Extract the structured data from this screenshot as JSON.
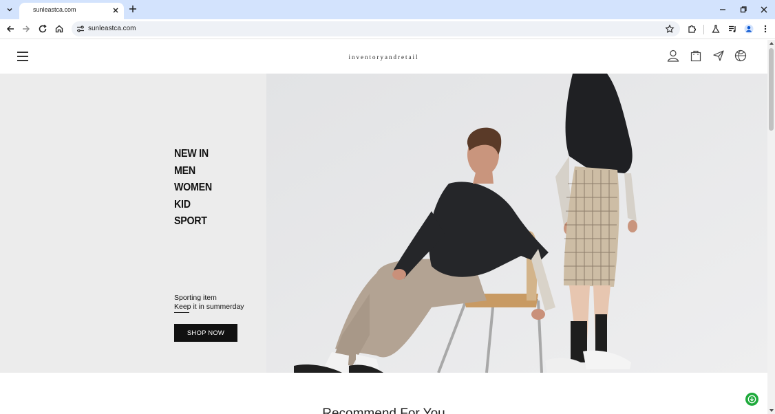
{
  "browser": {
    "tab_title": "sunleastca.com",
    "url": "sunleastca.com"
  },
  "site": {
    "brand": "inventoryandretail",
    "categories": [
      "NEW IN",
      "MEN",
      "WOMEN",
      "KID",
      "SPORT"
    ],
    "promo_title": "Sporting item",
    "promo_subtitle": "Keep it in summerday",
    "shop_button": "SHOP NOW",
    "section_title": "Recommend For You"
  },
  "colors": {
    "tabbar_bg": "#d3e3fd",
    "accent_chat": "#1faa3c",
    "button_bg": "#111111"
  }
}
